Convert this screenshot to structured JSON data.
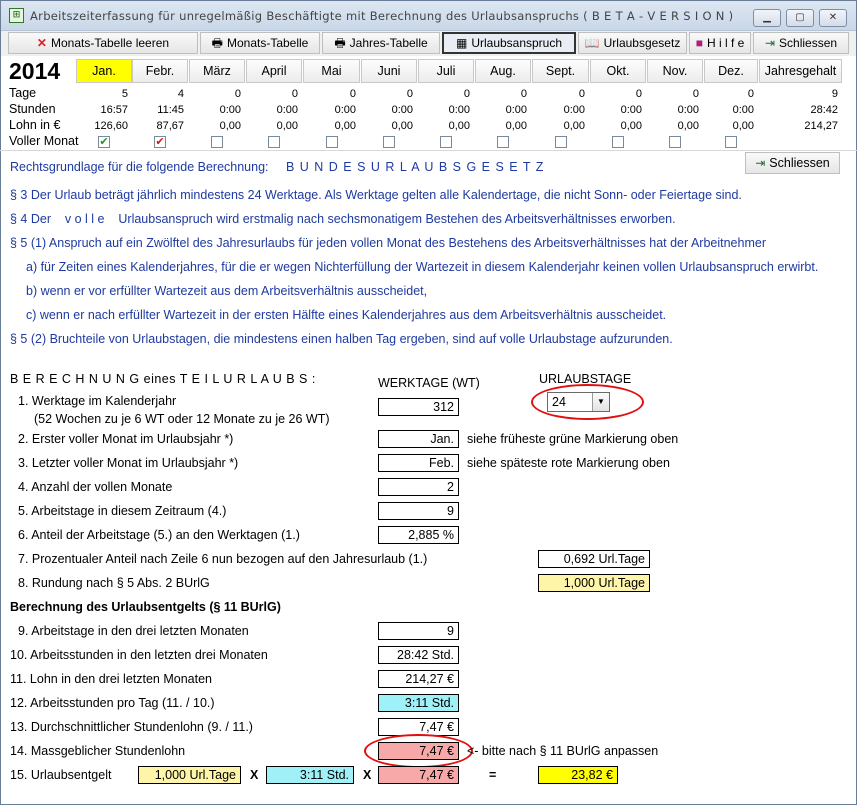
{
  "window": {
    "title": "Arbeitszeiterfassung für unregelmäßig Beschäftigte mit Berechnung des Urlaubsanspruchs ( B E T A  - V E R S I O N )",
    "minimize": "▁",
    "maximize": "▢",
    "close": "✕"
  },
  "toolbar": {
    "clear": "Monats-Tabelle leeren",
    "month": "Monats-Tabelle",
    "year": "Jahres-Tabelle",
    "vacation": "Urlaubsanspruch",
    "law": "Urlaubsgesetz",
    "help": "H i l f e",
    "close": "Schliessen"
  },
  "year": "2014",
  "months": [
    "Jan.",
    "Febr.",
    "März",
    "April",
    "Mai",
    "Juni",
    "Juli",
    "Aug.",
    "Sept.",
    "Okt.",
    "Nov.",
    "Dez.",
    "Jahresgehalt"
  ],
  "rows": {
    "labels": [
      "Tage",
      "Stunden",
      "Lohn in €",
      "Voller Monat"
    ],
    "tage": [
      "5",
      "4",
      "0",
      "0",
      "0",
      "0",
      "0",
      "0",
      "0",
      "0",
      "0",
      "0",
      "9"
    ],
    "stunden": [
      "16:57",
      "11:45",
      "0:00",
      "0:00",
      "0:00",
      "0:00",
      "0:00",
      "0:00",
      "0:00",
      "0:00",
      "0:00",
      "0:00",
      "28:42"
    ],
    "lohn": [
      "126,60",
      "87,67",
      "0,00",
      "0,00",
      "0,00",
      "0,00",
      "0,00",
      "0,00",
      "0,00",
      "0,00",
      "0,00",
      "0,00",
      "214,27"
    ],
    "voll": [
      true,
      true,
      false,
      false,
      false,
      false,
      false,
      false,
      false,
      false,
      false,
      false
    ]
  },
  "legal": {
    "heading": "Rechtsgrundlage für die folgende Berechnung:",
    "heading_law": "B U N D E S U R L A U B S G E S E T Z",
    "close": "Schliessen",
    "p1": "§ 3 Der Urlaub beträgt jährlich mindestens 24 Werktage. Als Werktage gelten alle Kalendertage, die nicht Sonn- oder Feiertage sind.",
    "p2": "§ 4 Der    v o l l e    Urlaubsanspruch wird erstmalig nach sechsmonatigem Bestehen des Arbeitsverhältnisses erworben.",
    "p3": "§ 5 (1) Anspruch auf ein Zwölftel des Jahresurlaubs für jeden vollen Monat des Bestehens des Arbeitsverhältnisses hat der Arbeitnehmer",
    "p3a": "a) für Zeiten eines Kalenderjahres, für die er wegen Nichterfüllung der Wartezeit in diesem Kalenderjahr keinen vollen Urlaubsanspruch erwirbt.",
    "p3b": "b) wenn er vor erfüllter Wartezeit aus dem Arbeitsverhältnis ausscheidet,",
    "p3c": "c) wenn er nach erfüllter Wartezeit in der ersten Hälfte eines Kalenderjahres aus dem Arbeitsverhältnis ausscheidet.",
    "p4": "§ 5 (2) Bruchteile von Urlaubstagen, die mindestens einen halben Tag ergeben, sind auf volle Urlaubstage aufzurunden."
  },
  "calc": {
    "heading": "B E R E C H N U N G  eines  T E I L U R L A U B S :",
    "col_wt": "WERKTAGE (WT)",
    "col_ut": "URLAUBSTAGE",
    "l1": "1.  Werktage im Kalenderjahr",
    "l1b": "(52 Wochen zu je 6 WT oder 12 Monate zu je 26 WT)",
    "v1": "312",
    "urlaubstage": "24",
    "l2": "2.  Erster voller Monat im Urlaubsjahr *)",
    "v2": "Jan.",
    "n2": "siehe früheste grüne Markierung oben",
    "l3": "3.  Letzter voller Monat im Urlaubsjahr *)",
    "v3": "Feb.",
    "n3": "siehe späteste rote Markierung oben",
    "l4": "4.  Anzahl der vollen Monate",
    "v4": "2",
    "l5": "5.  Arbeitstage in diesem Zeitraum (4.)",
    "v5": "9",
    "l6": "6.  Anteil der Arbeitstage (5.) an den Werktagen (1.)",
    "v6": "2,885 %",
    "l7": "7.  Prozentualer Anteil nach Zeile 6 nun bezogen auf den Jahresurlaub (1.)",
    "v7": "0,692 Url.Tage",
    "l8": "8.  Rundung nach § 5 Abs. 2 BUrlG",
    "v8": "1,000 Url.Tage",
    "heading2": "Berechnung des Urlaubsentgelts (§ 11 BUrlG)",
    "l9": "9.  Arbeitstage in den drei letzten Monaten",
    "v9": "9",
    "l10": "10.  Arbeitsstunden in den letzten drei Monaten",
    "v10": "28:42 Std.",
    "l11": "11.  Lohn in den drei letzten Monaten",
    "v11": "214,27 €",
    "l12": "12.  Arbeitsstunden pro Tag (11. / 10.)",
    "v12": "3:11 Std.",
    "l13": "13.  Durchschnittlicher Stundenlohn (9. / 11.)",
    "v13": "7,47 €",
    "l14": "14.  Massgeblicher Stundenlohn",
    "v14": "7,47 €",
    "n14": "<- bitte nach § 11 BUrlG anpassen",
    "l15": "15.  Urlaubsentgelt",
    "f1": "1,000 Url.Tage",
    "x1": "X",
    "f2": "3:11 Std.",
    "x2": "X",
    "f3": "7,47 €",
    "eq": "=",
    "result": "23,82 €"
  }
}
